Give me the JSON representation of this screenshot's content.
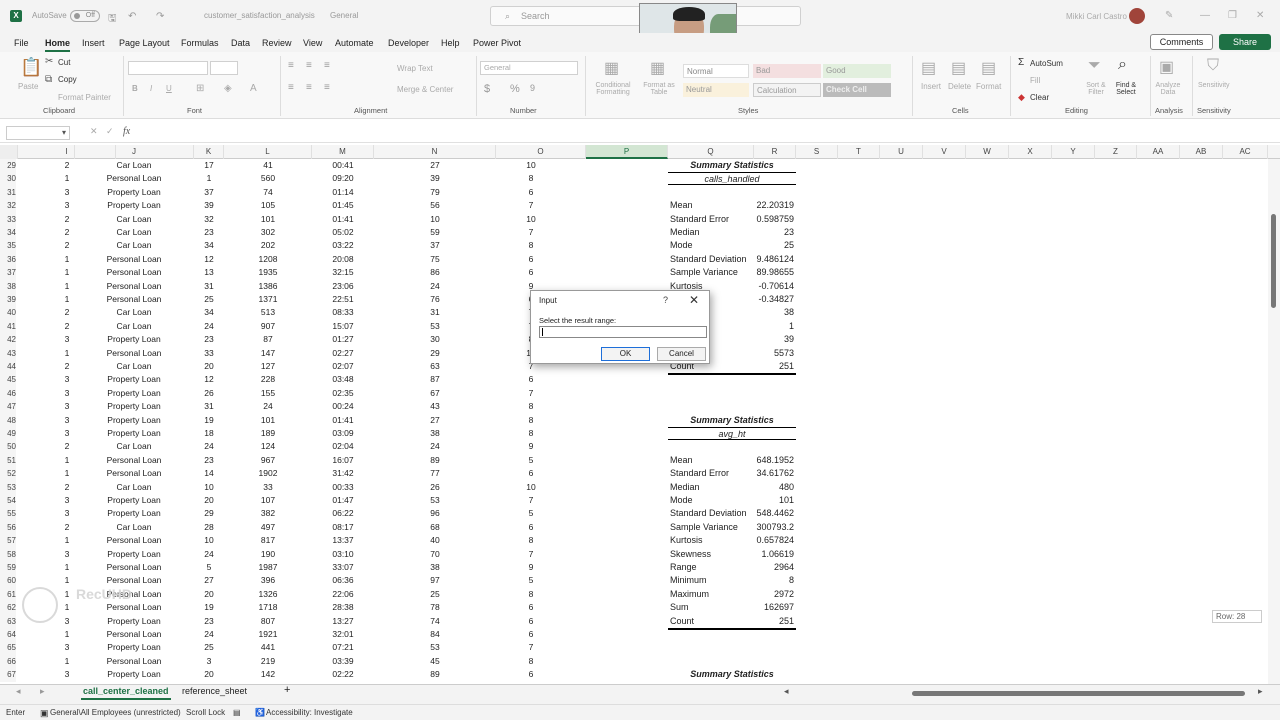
{
  "titlebar": {
    "app_icon": "X",
    "autosave_label": "AutoSave",
    "autosave_state": "Off",
    "doc_name": "customer_satisfaction_analysis",
    "sensitivity": "General",
    "search_placeholder": "Search",
    "user_name": "Mikki Carl Castro"
  },
  "menu": [
    "File",
    "Home",
    "Insert",
    "Page Layout",
    "Formulas",
    "Data",
    "Review",
    "View",
    "Automate",
    "Developer",
    "Help",
    "Power Pivot"
  ],
  "menu_active": "Home",
  "buttons": {
    "comments": "Comments",
    "share": "Share"
  },
  "ribbon": {
    "clipboard": {
      "paste": "Paste",
      "cut": "Cut",
      "copy": "Copy",
      "format_painter": "Format Painter",
      "label": "Clipboard"
    },
    "font": {
      "label": "Font",
      "bold": "B",
      "italic": "I",
      "underline": "U"
    },
    "alignment": {
      "label": "Alignment",
      "wrap": "Wrap Text",
      "merge": "Merge & Center"
    },
    "number": {
      "label": "Number",
      "format": "General"
    },
    "styles": {
      "label": "Styles",
      "conditional": "Conditional Formatting",
      "format_table": "Format as Table",
      "normal": "Normal",
      "bad": "Bad",
      "good": "Good",
      "neutral": "Neutral",
      "calculation": "Calculation",
      "check_cell": "Check Cell"
    },
    "cells": {
      "label": "Cells",
      "insert": "Insert",
      "delete": "Delete",
      "format": "Format"
    },
    "editing": {
      "label": "Editing",
      "autosum": "AutoSum",
      "fill": "Fill",
      "clear": "Clear",
      "sort": "Sort & Filter",
      "find": "Find & Select"
    },
    "analysis": {
      "label": "Analysis",
      "analyze": "Analyze Data"
    },
    "sensitivity": {
      "label": "Sensitivity",
      "btn": "Sensitivity"
    }
  },
  "formula_bar": {
    "fx": "fx",
    "content": ""
  },
  "columns": [
    "I",
    "J",
    "K",
    "L",
    "M",
    "N",
    "O",
    "P",
    "Q",
    "R",
    "S",
    "T",
    "U",
    "V",
    "W",
    "X",
    "Y",
    "Z",
    "AA",
    "AB",
    "AC"
  ],
  "selected_column": "P",
  "rows": [
    {
      "n": "29",
      "i": "2",
      "j": "Car Loan",
      "k": "17",
      "l": "41",
      "m": "00:41",
      "nn": "27",
      "o": "10"
    },
    {
      "n": "30",
      "i": "1",
      "j": "Personal Loan",
      "k": "1",
      "l": "560",
      "m": "09:20",
      "nn": "39",
      "o": "8"
    },
    {
      "n": "31",
      "i": "3",
      "j": "Property Loan",
      "k": "37",
      "l": "74",
      "m": "01:14",
      "nn": "79",
      "o": "6"
    },
    {
      "n": "32",
      "i": "3",
      "j": "Property Loan",
      "k": "39",
      "l": "105",
      "m": "01:45",
      "nn": "56",
      "o": "7"
    },
    {
      "n": "33",
      "i": "2",
      "j": "Car Loan",
      "k": "32",
      "l": "101",
      "m": "01:41",
      "nn": "10",
      "o": "10"
    },
    {
      "n": "34",
      "i": "2",
      "j": "Car Loan",
      "k": "23",
      "l": "302",
      "m": "05:02",
      "nn": "59",
      "o": "7"
    },
    {
      "n": "35",
      "i": "2",
      "j": "Car Loan",
      "k": "34",
      "l": "202",
      "m": "03:22",
      "nn": "37",
      "o": "8"
    },
    {
      "n": "36",
      "i": "1",
      "j": "Personal Loan",
      "k": "12",
      "l": "1208",
      "m": "20:08",
      "nn": "75",
      "o": "6"
    },
    {
      "n": "37",
      "i": "1",
      "j": "Personal Loan",
      "k": "13",
      "l": "1935",
      "m": "32:15",
      "nn": "86",
      "o": "6"
    },
    {
      "n": "38",
      "i": "1",
      "j": "Personal Loan",
      "k": "31",
      "l": "1386",
      "m": "23:06",
      "nn": "24",
      "o": "9"
    },
    {
      "n": "39",
      "i": "1",
      "j": "Personal Loan",
      "k": "25",
      "l": "1371",
      "m": "22:51",
      "nn": "76",
      "o": "6"
    },
    {
      "n": "40",
      "i": "2",
      "j": "Car Loan",
      "k": "34",
      "l": "513",
      "m": "08:33",
      "nn": "31",
      "o": "7"
    },
    {
      "n": "41",
      "i": "2",
      "j": "Car Loan",
      "k": "24",
      "l": "907",
      "m": "15:07",
      "nn": "53",
      "o": "7"
    },
    {
      "n": "42",
      "i": "3",
      "j": "Property Loan",
      "k": "23",
      "l": "87",
      "m": "01:27",
      "nn": "30",
      "o": "8"
    },
    {
      "n": "43",
      "i": "1",
      "j": "Personal Loan",
      "k": "33",
      "l": "147",
      "m": "02:27",
      "nn": "29",
      "o": "10"
    },
    {
      "n": "44",
      "i": "2",
      "j": "Car Loan",
      "k": "20",
      "l": "127",
      "m": "02:07",
      "nn": "63",
      "o": "7"
    },
    {
      "n": "45",
      "i": "3",
      "j": "Property Loan",
      "k": "12",
      "l": "228",
      "m": "03:48",
      "nn": "87",
      "o": "6"
    },
    {
      "n": "46",
      "i": "3",
      "j": "Property Loan",
      "k": "26",
      "l": "155",
      "m": "02:35",
      "nn": "67",
      "o": "7"
    },
    {
      "n": "47",
      "i": "3",
      "j": "Property Loan",
      "k": "31",
      "l": "24",
      "m": "00:24",
      "nn": "43",
      "o": "8"
    },
    {
      "n": "48",
      "i": "3",
      "j": "Property Loan",
      "k": "19",
      "l": "101",
      "m": "01:41",
      "nn": "27",
      "o": "8"
    },
    {
      "n": "49",
      "i": "3",
      "j": "Property Loan",
      "k": "18",
      "l": "189",
      "m": "03:09",
      "nn": "38",
      "o": "8"
    },
    {
      "n": "50",
      "i": "2",
      "j": "Car Loan",
      "k": "24",
      "l": "124",
      "m": "02:04",
      "nn": "24",
      "o": "9"
    },
    {
      "n": "51",
      "i": "1",
      "j": "Personal Loan",
      "k": "23",
      "l": "967",
      "m": "16:07",
      "nn": "89",
      "o": "5"
    },
    {
      "n": "52",
      "i": "1",
      "j": "Personal Loan",
      "k": "14",
      "l": "1902",
      "m": "31:42",
      "nn": "77",
      "o": "6"
    },
    {
      "n": "53",
      "i": "2",
      "j": "Car Loan",
      "k": "10",
      "l": "33",
      "m": "00:33",
      "nn": "26",
      "o": "10"
    },
    {
      "n": "54",
      "i": "3",
      "j": "Property Loan",
      "k": "20",
      "l": "107",
      "m": "01:47",
      "nn": "53",
      "o": "7"
    },
    {
      "n": "55",
      "i": "3",
      "j": "Property Loan",
      "k": "29",
      "l": "382",
      "m": "06:22",
      "nn": "96",
      "o": "5"
    },
    {
      "n": "56",
      "i": "2",
      "j": "Car Loan",
      "k": "28",
      "l": "497",
      "m": "08:17",
      "nn": "68",
      "o": "6"
    },
    {
      "n": "57",
      "i": "1",
      "j": "Personal Loan",
      "k": "10",
      "l": "817",
      "m": "13:37",
      "nn": "40",
      "o": "8"
    },
    {
      "n": "58",
      "i": "3",
      "j": "Property Loan",
      "k": "24",
      "l": "190",
      "m": "03:10",
      "nn": "70",
      "o": "7"
    },
    {
      "n": "59",
      "i": "1",
      "j": "Personal Loan",
      "k": "5",
      "l": "1987",
      "m": "33:07",
      "nn": "38",
      "o": "9"
    },
    {
      "n": "60",
      "i": "1",
      "j": "Personal Loan",
      "k": "27",
      "l": "396",
      "m": "06:36",
      "nn": "97",
      "o": "5"
    },
    {
      "n": "61",
      "i": "1",
      "j": "Personal Loan",
      "k": "20",
      "l": "1326",
      "m": "22:06",
      "nn": "25",
      "o": "8"
    },
    {
      "n": "62",
      "i": "1",
      "j": "Personal Loan",
      "k": "19",
      "l": "1718",
      "m": "28:38",
      "nn": "78",
      "o": "6"
    },
    {
      "n": "63",
      "i": "3",
      "j": "Property Loan",
      "k": "23",
      "l": "807",
      "m": "13:27",
      "nn": "74",
      "o": "6"
    },
    {
      "n": "64",
      "i": "1",
      "j": "Personal Loan",
      "k": "24",
      "l": "1921",
      "m": "32:01",
      "nn": "84",
      "o": "6"
    },
    {
      "n": "65",
      "i": "3",
      "j": "Property Loan",
      "k": "25",
      "l": "441",
      "m": "07:21",
      "nn": "53",
      "o": "7"
    },
    {
      "n": "66",
      "i": "1",
      "j": "Personal Loan",
      "k": "3",
      "l": "219",
      "m": "03:39",
      "nn": "45",
      "o": "8"
    },
    {
      "n": "67",
      "i": "3",
      "j": "Property Loan",
      "k": "20",
      "l": "142",
      "m": "02:22",
      "nn": "89",
      "o": "6"
    }
  ],
  "stats1": {
    "title": "Summary Statistics",
    "subtitle": "calls_handled",
    "items": [
      {
        "label": "Mean",
        "value": "22.20319"
      },
      {
        "label": "Standard Error",
        "value": "0.598759"
      },
      {
        "label": "Median",
        "value": "23"
      },
      {
        "label": "Mode",
        "value": "25"
      },
      {
        "label": "Standard Deviation",
        "value": "9.486124"
      },
      {
        "label": "Sample Variance",
        "value": "89.98655"
      },
      {
        "label": "Kurtosis",
        "value": "-0.70614"
      },
      {
        "label": "",
        "value": "-0.34827"
      },
      {
        "label": "",
        "value": "38"
      },
      {
        "label": "",
        "value": "1"
      },
      {
        "label": "",
        "value": "39"
      },
      {
        "label": "",
        "value": "5573"
      },
      {
        "label": "Count",
        "value": "251"
      }
    ]
  },
  "stats2": {
    "title": "Summary Statistics",
    "subtitle": "avg_ht",
    "items": [
      {
        "label": "Mean",
        "value": "648.1952"
      },
      {
        "label": "Standard Error",
        "value": "34.61762"
      },
      {
        "label": "Median",
        "value": "480"
      },
      {
        "label": "Mode",
        "value": "101"
      },
      {
        "label": "Standard Deviation",
        "value": "548.4462"
      },
      {
        "label": "Sample Variance",
        "value": "300793.2"
      },
      {
        "label": "Kurtosis",
        "value": "0.657824"
      },
      {
        "label": "Skewness",
        "value": "1.06619"
      },
      {
        "label": "Range",
        "value": "2964"
      },
      {
        "label": "Minimum",
        "value": "8"
      },
      {
        "label": "Maximum",
        "value": "2972"
      },
      {
        "label": "Sum",
        "value": "162697"
      },
      {
        "label": "Count",
        "value": "251"
      }
    ]
  },
  "stats3": {
    "title": "Summary Statistics"
  },
  "dialog": {
    "title": "Input",
    "help": "?",
    "close": "✕",
    "label": "Select the result range:",
    "input_value": "",
    "ok": "OK",
    "cancel": "Cancel"
  },
  "sheets": [
    "call_center_cleaned",
    "reference_sheet"
  ],
  "active_sheet": "call_center_cleaned",
  "add_sheet": "+",
  "row_tip": "Row: 28",
  "status": {
    "mode": "Enter",
    "sensitivity": "General\\All Employees (unrestricted)",
    "scroll_lock": "Scroll Lock",
    "accessibility": "Accessibility: Investigate"
  },
  "watermark": "RecUHD"
}
